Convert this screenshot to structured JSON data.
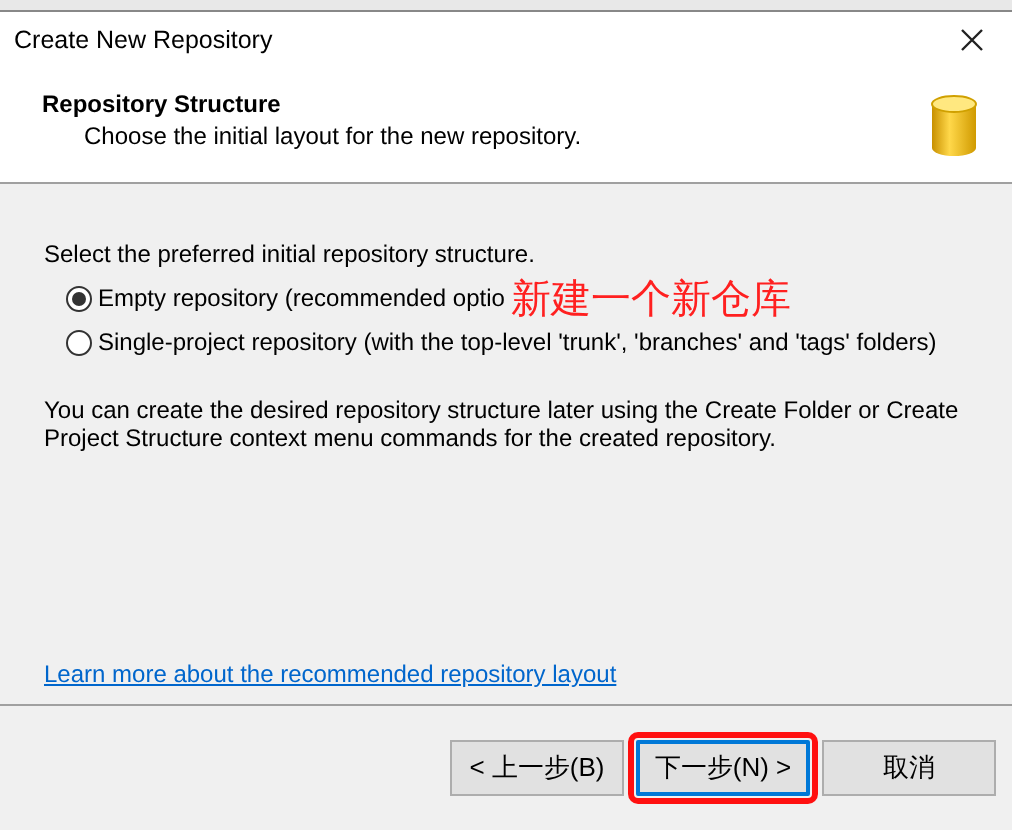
{
  "window": {
    "title": "Create New Repository"
  },
  "header": {
    "title": "Repository Structure",
    "subtitle": "Choose the initial layout for the new repository."
  },
  "prompt": "Select the preferred initial repository structure.",
  "options": [
    {
      "label": "Empty repository (recommended optio",
      "selected": true
    },
    {
      "label": "Single-project repository (with the top-level 'trunk', 'branches' and 'tags' folders)",
      "selected": false
    }
  ],
  "annotation": {
    "text": "新建一个新仓库",
    "color": "#ff2020"
  },
  "note": "You can create the desired repository structure later using the Create Folder or Create Project Structure context menu commands for the created repository.",
  "link": "Learn more about the recommended repository layout",
  "buttons": [
    {
      "label": "< 上一步(B)",
      "default": false,
      "highlighted": false
    },
    {
      "label": "下一步(N) >",
      "default": true,
      "highlighted": true
    },
    {
      "label": "取消",
      "default": false,
      "highlighted": false
    }
  ]
}
